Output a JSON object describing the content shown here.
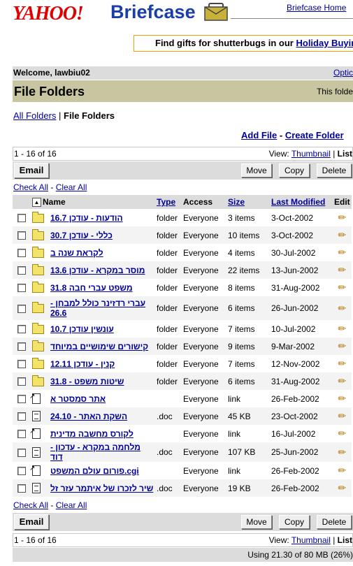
{
  "header": {
    "logo": "YAHOO!",
    "product": "Briefcase",
    "home_link": "Briefcase Home",
    "promo_text": "Find gifts for shutterbugs in our ",
    "promo_link": "Holiday Buyin"
  },
  "welcome": {
    "text": "Welcome, lawbiu02",
    "options_link": "Optic"
  },
  "section": {
    "title": "File Folders",
    "desc": "This folde"
  },
  "breadcrumb": {
    "all": "All Folders",
    "sep": " | ",
    "current": "File Folders"
  },
  "actions": {
    "add_file": "Add File",
    "sep": " - ",
    "create_folder": "Create Folder"
  },
  "pager": {
    "count": "1 - 16 of 16",
    "view_label": "View: ",
    "thumbnail": "Thumbnail",
    "sep": " | ",
    "list": "List"
  },
  "toolbar": {
    "email": "Email",
    "move": "Move",
    "copy": "Copy",
    "delete": "Delete"
  },
  "select": {
    "check_all": "Check All",
    "sep": " - ",
    "clear_all": "Clear All"
  },
  "columns": {
    "name": "Name",
    "type": "Type",
    "access": "Access",
    "size": "Size",
    "modified": "Last Modified",
    "edit": "Edit"
  },
  "rows": [
    {
      "kind": "folder",
      "name": "הודעות - עודכן 16.7",
      "type": "folder",
      "access": "Everyone",
      "size": "3 items",
      "date": "3-Oct-2002"
    },
    {
      "kind": "folder",
      "name": "כללי - עודכן 30.7",
      "type": "folder",
      "access": "Everyone",
      "size": "10 items",
      "date": "3-Oct-2002"
    },
    {
      "kind": "folder",
      "name": "לקראת שנה ב",
      "type": "folder",
      "access": "Everyone",
      "size": "4 items",
      "date": "30-Jul-2002"
    },
    {
      "kind": "folder",
      "name": "מוסר במקרא - עודכן 13.6",
      "type": "folder",
      "access": "Everyone",
      "size": "22 items",
      "date": "13-Jun-2002"
    },
    {
      "kind": "folder",
      "name": "משפט עברי חבה 31.8",
      "type": "folder",
      "access": "Everyone",
      "size": "8 items",
      "date": "31-Aug-2002"
    },
    {
      "kind": "folder",
      "name": "עברי רדזינר כולל למבחן - 26.6",
      "type": "folder",
      "access": "Everyone",
      "size": "6 items",
      "date": "26-Jun-2002"
    },
    {
      "kind": "folder",
      "name": "עונשין עודכן 10.7",
      "type": "folder",
      "access": "Everyone",
      "size": "7 items",
      "date": "10-Jul-2002"
    },
    {
      "kind": "folder",
      "name": "קישורים שימושיים במיוחד",
      "type": "folder",
      "access": "Everyone",
      "size": "9 items",
      "date": "9-Mar-2002"
    },
    {
      "kind": "folder",
      "name": "קנין - עודכן 12.11",
      "type": "folder",
      "access": "Everyone",
      "size": "7 items",
      "date": "12-Nov-2002"
    },
    {
      "kind": "folder",
      "name": "שיטות משפט - 31.8",
      "type": "folder",
      "access": "Everyone",
      "size": "6 items",
      "date": "31-Aug-2002"
    },
    {
      "kind": "link",
      "name": "אתר סמסטר א",
      "type": "",
      "access": "Everyone",
      "size": "link",
      "date": "26-Feb-2002"
    },
    {
      "kind": "doc",
      "name": "השקת האתר - 24.10",
      "type": ".doc",
      "access": "Everyone",
      "size": "45 KB",
      "date": "23-Oct-2002"
    },
    {
      "kind": "link",
      "name": "לקורס מחשבה מדינית",
      "type": "",
      "access": "Everyone",
      "size": "link",
      "date": "16-Jul-2002"
    },
    {
      "kind": "doc",
      "name": "מלחמה במקרא - עדכון - דוד",
      "type": ".doc",
      "access": "Everyone",
      "size": "107 KB",
      "date": "25-Jun-2002"
    },
    {
      "kind": "link",
      "name": "פורום עולם המשפט.cgi",
      "type": "",
      "access": "Everyone",
      "size": "link",
      "date": "26-Feb-2002"
    },
    {
      "kind": "doc",
      "name": "שיר לזכרו של איתמר עזר זל",
      "type": ".doc",
      "access": "Everyone",
      "size": "19 KB",
      "date": "26-Feb-2002"
    }
  ],
  "usage": "Using 21.30 of 80 MB (26%)"
}
